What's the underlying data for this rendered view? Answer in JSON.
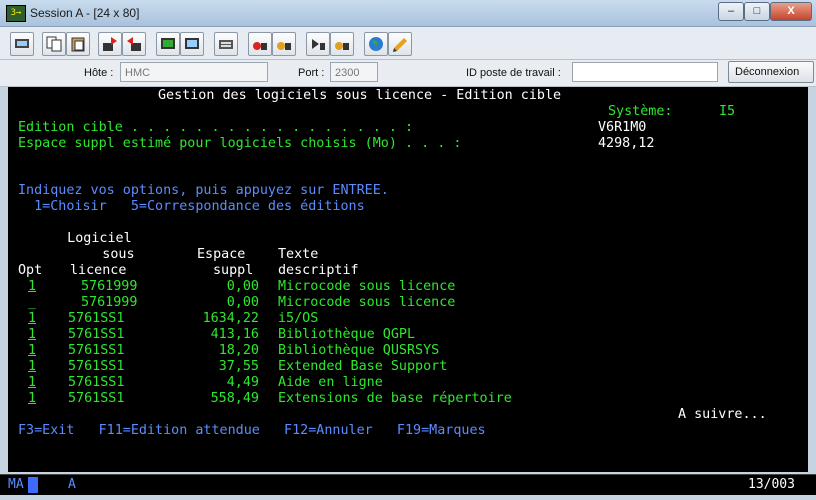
{
  "window": {
    "title": "Session A - [24 x 80]",
    "icon_label": "3→",
    "controls": [
      "–",
      "□",
      "X"
    ]
  },
  "toolbar": {
    "icons": [
      "print-screen-icon",
      "copy-icon",
      "paste-icon",
      "send-icon",
      "receive-icon",
      "display-icon",
      "keypad-icon",
      "macro-icon",
      "record-icon",
      "play-icon",
      "stop-icon",
      "play-macro-icon",
      "record-macro-icon",
      "globe-icon",
      "help-icon"
    ]
  },
  "connection": {
    "host_label": "Hôte :",
    "host_value": "HMC",
    "port_label": "Port :",
    "port_value": "2300",
    "workstation_label": "ID poste de travail :",
    "workstation_value": "",
    "disconnect_label": "Déconnexion"
  },
  "screen": {
    "header": "Gestion des logiciels sous licence - Edition cible",
    "system_label": "Système:",
    "system_value": "I5",
    "target_label": "Edition cible . . . . . . . . . . . . . . . . . :",
    "target_value": "V6R1M0",
    "space_label": "Espace suppl estimé pour logiciels choisis (Mo) . . . :",
    "space_value": "4298,12",
    "instructions": "Indiquez vos options, puis appuyez sur ENTREE.",
    "options": "  1=Choisir   5=Correspondance des éditions",
    "col_head1": "   Logiciel",
    "col_head2a": "     sous",
    "col_head2b": "Espace",
    "col_head2c": "Texte",
    "col_head3a": "Opt",
    "col_head3b": "licence",
    "col_head3c": "suppl",
    "col_head3d": "descriptif",
    "rows": [
      {
        "opt": "1",
        "product": "5761999",
        "space": "0,00",
        "text": "Microcode sous licence"
      },
      {
        "opt": "_",
        "product": "5761999",
        "space": "0,00",
        "text": "Microcode sous licence"
      },
      {
        "opt": "1",
        "product": "5761SS1",
        "space": "1634,22",
        "text": "i5/OS"
      },
      {
        "opt": "1",
        "product": "5761SS1",
        "space": "413,16",
        "text": "Bibliothèque QGPL"
      },
      {
        "opt": "1",
        "product": "5761SS1",
        "space": "18,20",
        "text": "Bibliothèque QUSRSYS"
      },
      {
        "opt": "1",
        "product": "5761SS1",
        "space": "37,55",
        "text": "Extended Base Support"
      },
      {
        "opt": "1",
        "product": "5761SS1",
        "space": "4,49",
        "text": "Aide en ligne"
      },
      {
        "opt": "1",
        "product": "5761SS1",
        "space": "558,49",
        "text": "Extensions de base répertoire"
      }
    ],
    "more": "A suivre...",
    "fkeys": "F3=Exit   F11=Edition attendue   F12=Annuler   F19=Marques"
  },
  "status": {
    "mode": "MA",
    "indicator": "A",
    "position": "13/003"
  }
}
